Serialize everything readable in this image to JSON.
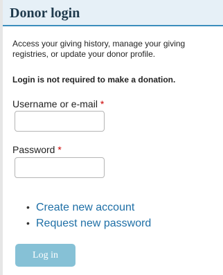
{
  "block": {
    "title": "Donor login",
    "description": "Access your giving history, manage your giving registries, or update your donor profile.",
    "notice": "Login is not required to make a donation."
  },
  "form": {
    "username_label": "Username or e-mail",
    "password_label": "Password",
    "required_mark": "*",
    "username_value": "",
    "password_value": ""
  },
  "links": {
    "bullet": "•",
    "create_account": "Create new account",
    "request_password": "Request new password"
  },
  "actions": {
    "login_label": "Log in"
  },
  "colors": {
    "header_background": "#e6f0f7",
    "header_border": "#3b8dbd",
    "link": "#1e6fa6",
    "required": "#cc0000",
    "button": "#86c1d6"
  }
}
